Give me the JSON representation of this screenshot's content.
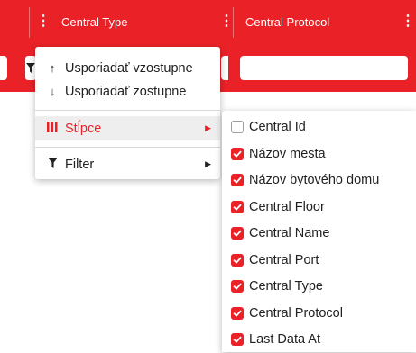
{
  "header": {
    "columns": [
      {
        "label": "Central Type"
      },
      {
        "label": "Central Protocol"
      }
    ],
    "menu_icon": "vertical-dots-icon",
    "accent_color": "#ea2227"
  },
  "column_menu": {
    "sort_asc": {
      "icon": "arrow-up-icon",
      "glyph": "↑",
      "label": "Usporiadať vzostupne"
    },
    "sort_desc": {
      "icon": "arrow-down-icon",
      "glyph": "↓",
      "label": "Usporiadať zostupne"
    },
    "columns_item": {
      "icon": "columns-icon",
      "label": "Stĺpce",
      "active": true
    },
    "filter_item": {
      "icon": "filter-icon",
      "label": "Filter"
    }
  },
  "columns_submenu": {
    "items": [
      {
        "label": "Central Id",
        "checked": false
      },
      {
        "label": "Názov mesta",
        "checked": true
      },
      {
        "label": "Názov bytového domu",
        "checked": true
      },
      {
        "label": "Central Floor",
        "checked": true
      },
      {
        "label": "Central Name",
        "checked": true
      },
      {
        "label": "Central Port",
        "checked": true
      },
      {
        "label": "Central Type",
        "checked": true
      },
      {
        "label": "Central Protocol",
        "checked": true
      },
      {
        "label": "Last Data At",
        "checked": true
      }
    ]
  }
}
